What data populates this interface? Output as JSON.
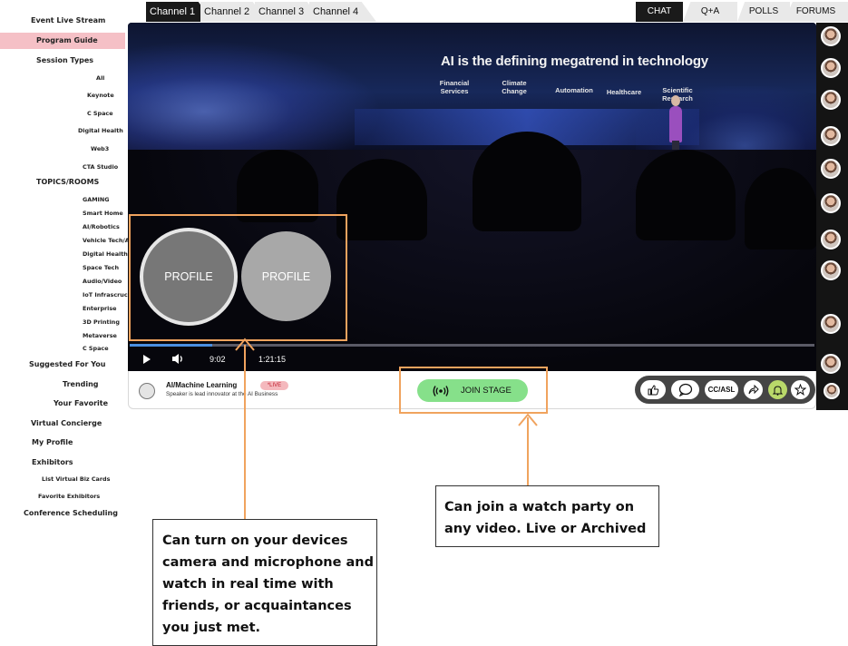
{
  "sidebar": {
    "items": [
      {
        "label": "Event Live Stream"
      },
      {
        "label": "Program Guide"
      },
      {
        "label": "Session Types"
      },
      {
        "label": "All"
      },
      {
        "label": "Keynote"
      },
      {
        "label": "C Space"
      },
      {
        "label": "Digital Health"
      },
      {
        "label": "Web3"
      },
      {
        "label": "CTA Studio"
      },
      {
        "label": "TOPICS/ROOMS"
      },
      {
        "label": "GAMING"
      },
      {
        "label": "Smart Home"
      },
      {
        "label": "AI/Robotics"
      },
      {
        "label": "Vehicle Tech/A"
      },
      {
        "label": "Digital Health"
      },
      {
        "label": "Space Tech"
      },
      {
        "label": "Audio/Video"
      },
      {
        "label": "IoT Infrascruc"
      },
      {
        "label": "Enterprise"
      },
      {
        "label": "3D Printing"
      },
      {
        "label": "Metaverse"
      },
      {
        "label": "C Space"
      },
      {
        "label": "Suggested For You"
      },
      {
        "label": "Trending"
      },
      {
        "label": "Your Favorite"
      },
      {
        "label": "Virtual Concierge"
      },
      {
        "label": "My Profile"
      },
      {
        "label": "Exhibitors"
      },
      {
        "label": "List Virtual Biz Cards"
      },
      {
        "label": "Favorite Exhibitors"
      },
      {
        "label": "Conference Scheduling"
      }
    ],
    "active_index": 1,
    "active_color": "#f5c0c6"
  },
  "channels": {
    "tabs": [
      {
        "label": "Channel 1",
        "active": true
      },
      {
        "label": "Channel 2",
        "active": false
      },
      {
        "label": "Channel 3",
        "active": false
      },
      {
        "label": "Channel 4",
        "active": false
      }
    ]
  },
  "right_tabs": {
    "tabs": [
      {
        "label": "CHAT",
        "active": true
      },
      {
        "label": "Q+A",
        "active": false
      },
      {
        "label": "POLLS",
        "active": false
      },
      {
        "label": "FORUMS",
        "active": false
      }
    ]
  },
  "video": {
    "slide": {
      "title": "AI is the defining megatrend in technology",
      "categories": [
        "Financial Services",
        "Climate Change",
        "Automation",
        "Healthcare",
        "Scientific Research"
      ]
    },
    "profiles": [
      {
        "label": "PROFILE"
      },
      {
        "label": "PROFILE"
      }
    ],
    "controls": {
      "current_time": "9:02",
      "duration": "1:21:15",
      "progress": 0.12
    }
  },
  "session": {
    "title": "AI/Machine Learning",
    "live_badge": "*LIVE",
    "subtitle": "Speaker is lead innovator at the AI Business",
    "join_label": "JOIN STAGE",
    "join_color": "#86e08a",
    "actions": {
      "cc_label": "CC/ASL"
    }
  },
  "annotations": {
    "accent": "#f0a35e",
    "watch_party": "Can join a watch party on any video. Live or Archived",
    "camera": "Can turn on your devices camera and microphone and watch in real time with friends, or acquaintances you just met."
  },
  "chat_avatars": 11
}
